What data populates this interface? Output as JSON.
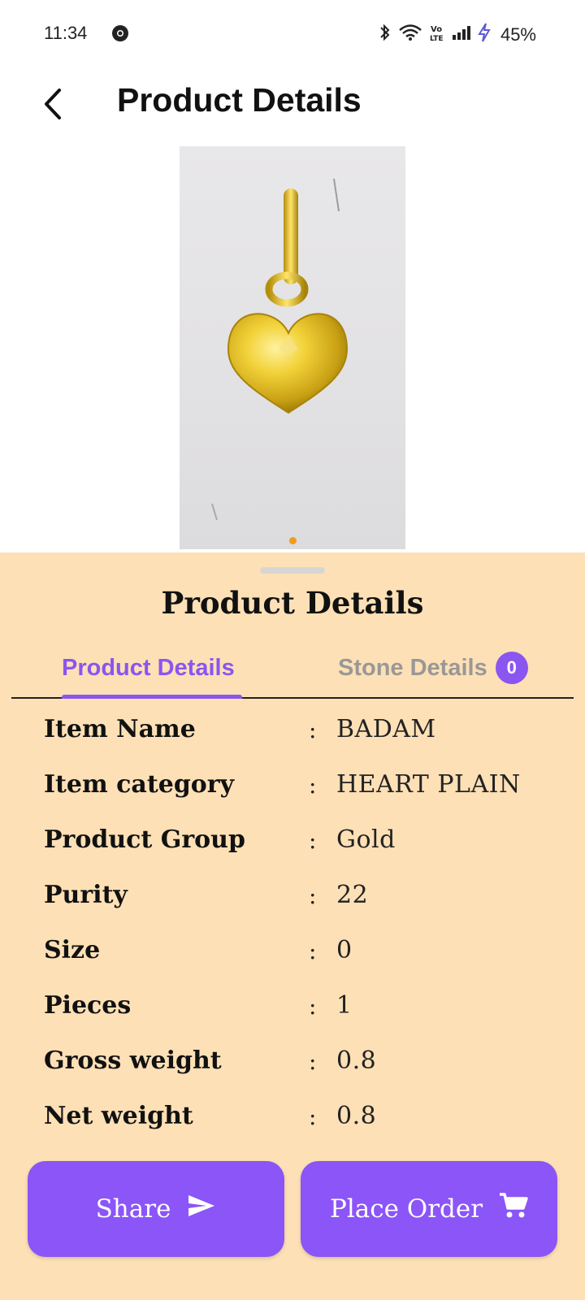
{
  "status_bar": {
    "time": "11:34",
    "battery": "45%",
    "icons": [
      "chrome-icon",
      "bluetooth-icon",
      "wifi-icon",
      "volte-icon",
      "signal-icon",
      "charging-icon"
    ]
  },
  "app_bar": {
    "title": "Product Details"
  },
  "gallery": {
    "image_subject": "gold heart pendant",
    "dot_color": "#f39a1e"
  },
  "sheet": {
    "title": "Product Details",
    "tabs": [
      {
        "label": "Product Details",
        "active": true
      },
      {
        "label": "Stone Details",
        "badge": "0",
        "active": false
      }
    ],
    "rows": [
      {
        "label": "Item Name",
        "value": "BADAM"
      },
      {
        "label": "Item category",
        "value": "HEART PLAIN"
      },
      {
        "label": "Product Group",
        "value": "Gold"
      },
      {
        "label": "Purity",
        "value": "22"
      },
      {
        "label": "Size",
        "value": "0"
      },
      {
        "label": "Pieces",
        "value": "1"
      },
      {
        "label": "Gross weight",
        "value": "0.8"
      },
      {
        "label": "Net weight",
        "value": "0.8"
      }
    ]
  },
  "actions": {
    "share_label": "Share",
    "order_label": "Place Order"
  },
  "colors": {
    "accent": "#8b55f7",
    "sheet_bg": "#fde0b6",
    "inactive_tab": "#9a9896"
  }
}
